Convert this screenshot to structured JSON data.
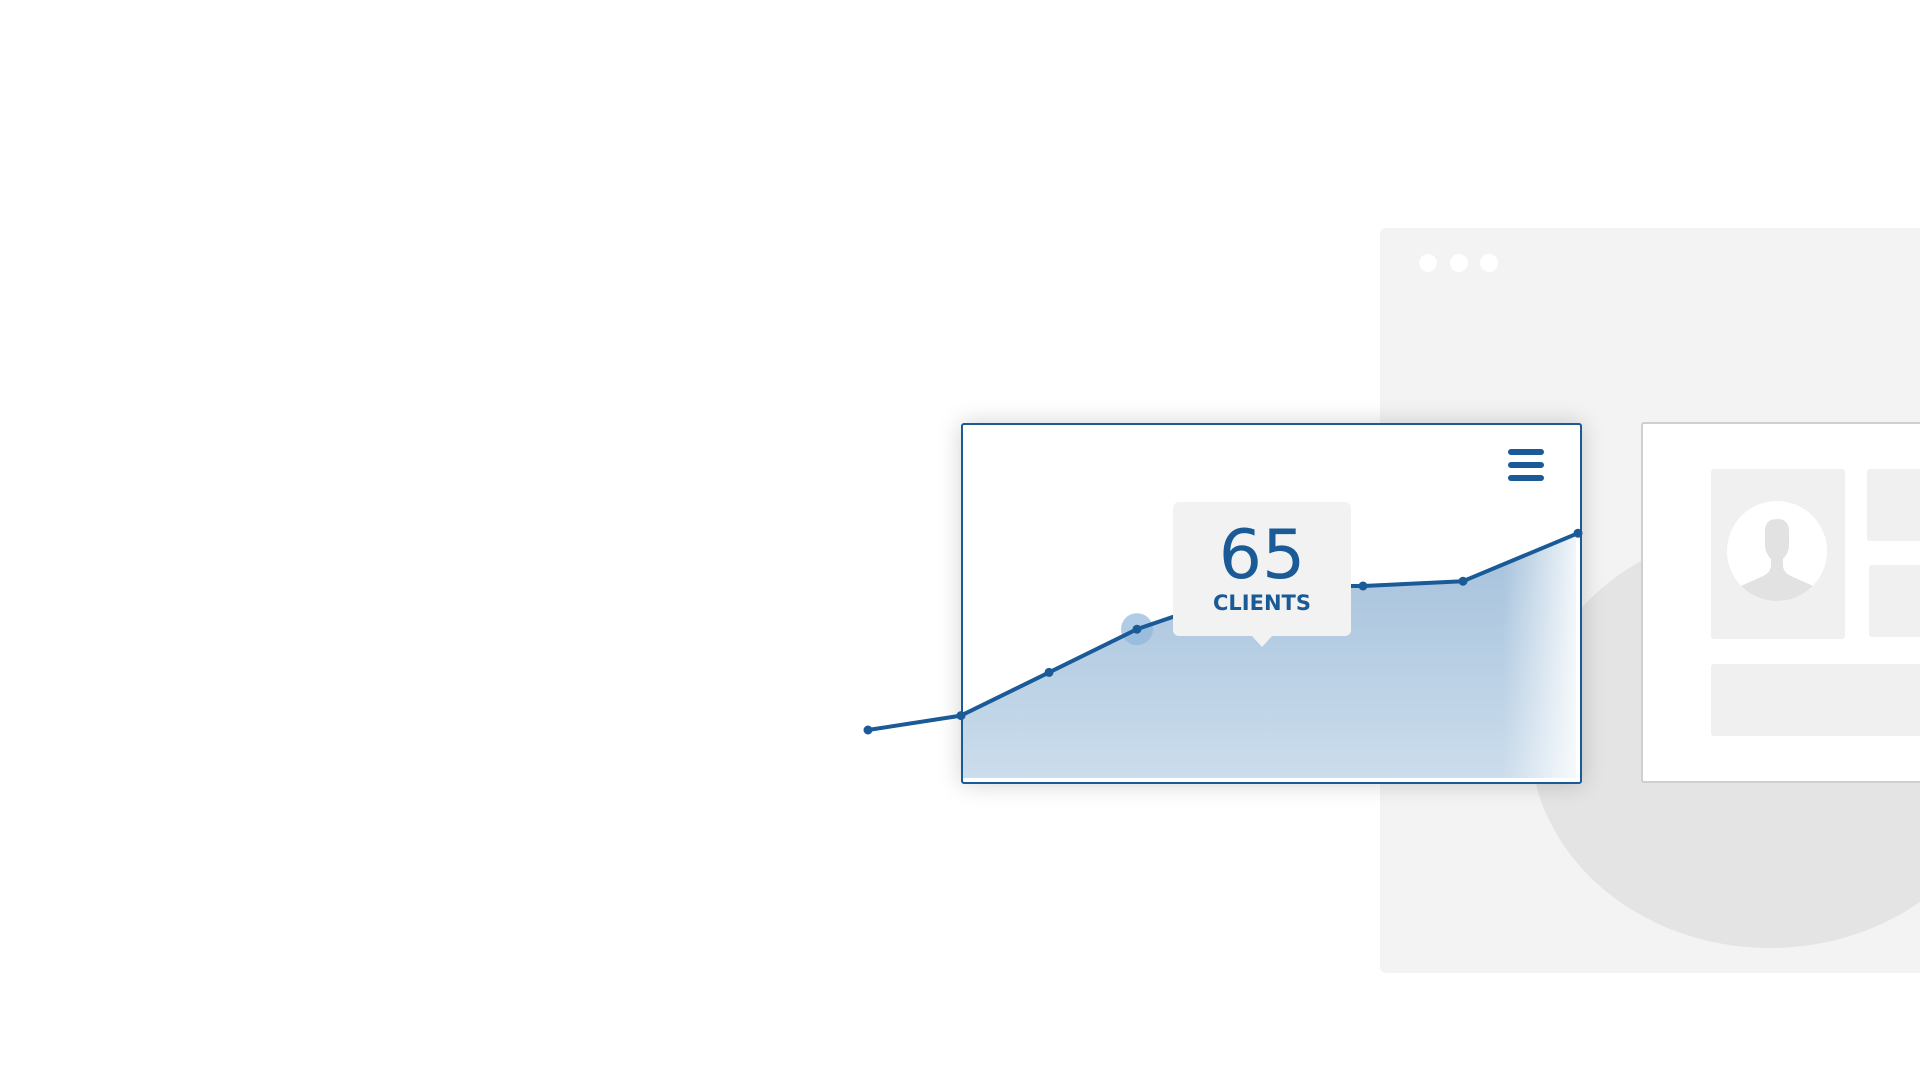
{
  "stat": {
    "value": "65",
    "unit": "CLIENTS"
  },
  "colors": {
    "accent": "#1a5a97",
    "fill": "#a9c4dd",
    "highlight": "#8fb6dc",
    "panel": "#f3f3f3",
    "card_border": "#cfcfcf"
  },
  "icons": [
    "window-dot-icon",
    "hamburger-menu-icon",
    "user-avatar-icon"
  ],
  "chart_data": {
    "type": "area",
    "values": [
      10,
      13,
      22,
      31,
      40,
      40,
      41,
      51
    ],
    "highlight_index": 3
  }
}
